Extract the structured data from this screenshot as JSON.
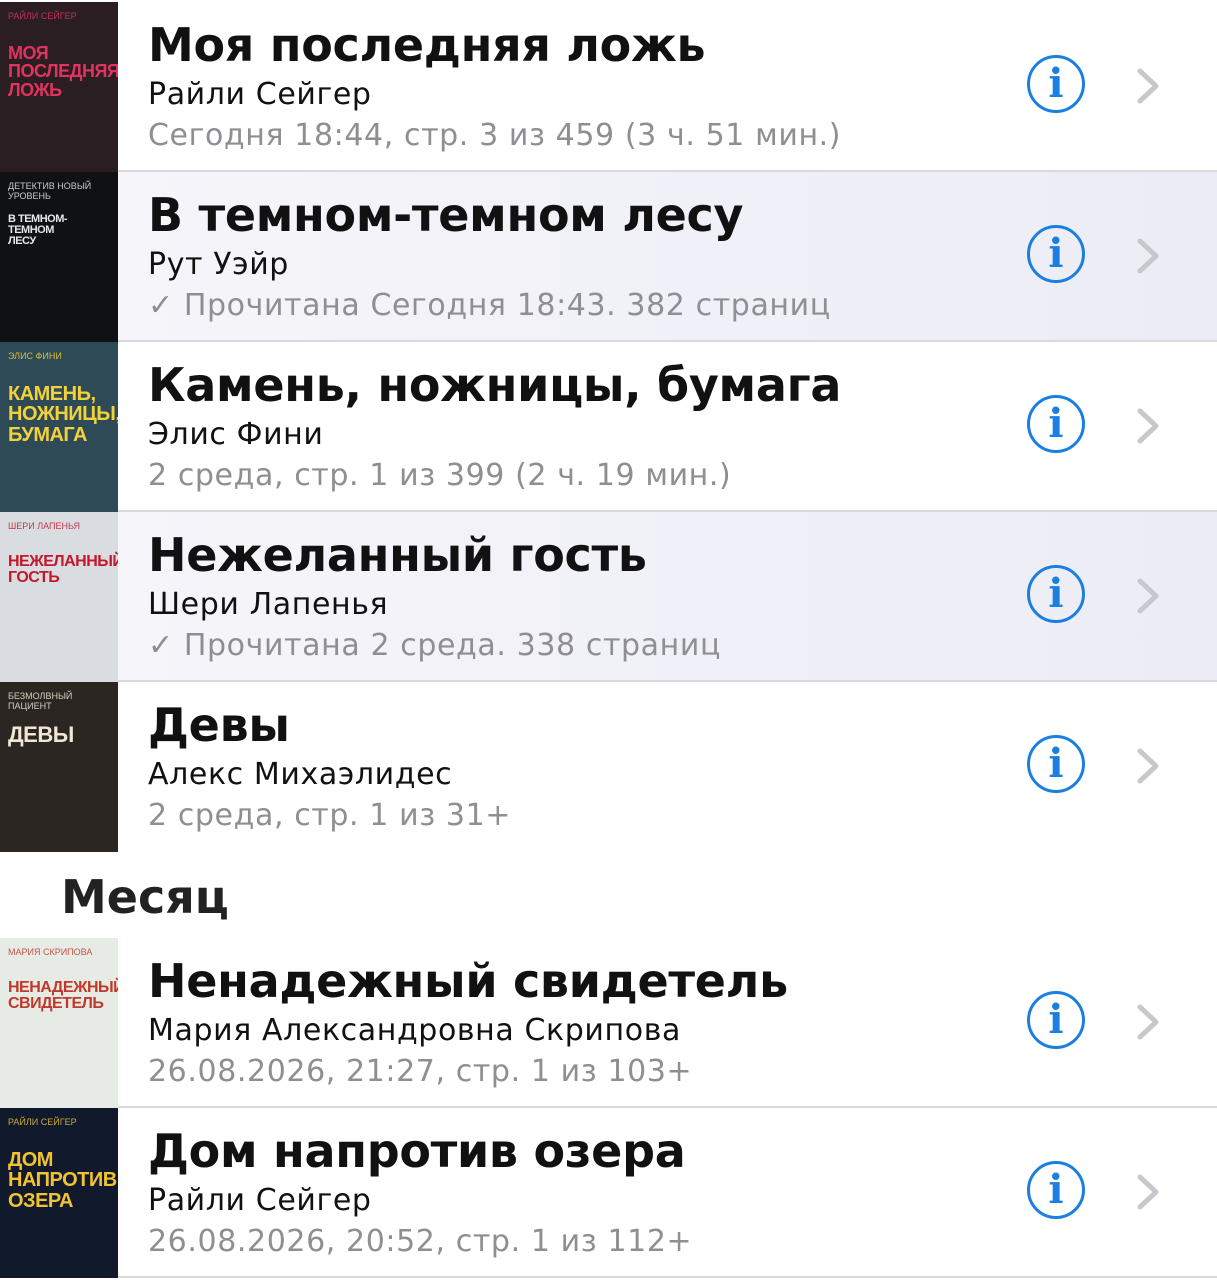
{
  "books_recent": [
    {
      "title": "Моя последняя ложь",
      "author": "Райли Сейгер",
      "status": "Сегодня 18:44, стр. 3 из 459 (3 ч. 51 мин.)",
      "finished": false,
      "cover": {
        "lines": [
          "МОЯ",
          "ПОСЛЕДНЯЯ",
          "ЛОЖЬ"
        ],
        "small": "РАЙЛИ СЕЙГЕР",
        "bg": "#2a1e22",
        "fg": "#e0335f"
      }
    },
    {
      "title": "В темном-темном лесу",
      "author": "Рут Уэйр",
      "status": "✓ Прочитана Сегодня 18:43. 382 страниц",
      "finished": true,
      "cover": {
        "lines": [
          "В ТЕМНОМ-ТЕМНОМ",
          "ЛЕСУ"
        ],
        "small": "ДЕТЕКТИВ НОВЫЙ УРОВЕНЬ",
        "bg": "#0f1114",
        "fg": "#e6e6e6"
      }
    },
    {
      "title": "Камень, ножницы, бумага",
      "author": "Элис Фини",
      "status": "2 среда, стр. 1 из 399 (2 ч. 19 мин.)",
      "finished": false,
      "cover": {
        "lines": [
          "КАМЕНЬ,",
          "НОЖНИЦЫ,",
          "БУМАГА"
        ],
        "small": "ЭЛИС ФИНИ",
        "bg": "#2f4a57",
        "fg": "#f2d23a"
      }
    },
    {
      "title": "Нежеланный гость",
      "author": "Шери Лапенья",
      "status": "✓ Прочитана 2 среда. 338 страниц",
      "finished": true,
      "cover": {
        "lines": [
          "НЕЖЕЛАННЫЙ",
          "ГОСТЬ"
        ],
        "small": "ШЕРИ ЛАПЕНЬЯ",
        "bg": "#d9dde2",
        "fg": "#c4182a"
      }
    },
    {
      "title": "Девы",
      "author": "Алекс Михаэлидес",
      "status": "2 среда, стр. 1 из 31+",
      "finished": false,
      "cover": {
        "lines": [
          "ДЕВЫ"
        ],
        "small": "БЕЗМОЛВНЫЙ ПАЦИЕНТ",
        "bg": "#2b2622",
        "fg": "#f0e6d6"
      }
    }
  ],
  "section_month": "Месяц",
  "books_month": [
    {
      "title": "Ненадежный свидетель",
      "author": "Мария Александровна Скрипова",
      "status": "26.08.2026, 21:27, стр. 1 из 103+",
      "finished": false,
      "cover": {
        "lines": [
          "НЕНАДЕЖНЫЙ",
          "СВИДЕТЕЛЬ"
        ],
        "small": "МАРИЯ СКРИПОВА",
        "bg": "#e7ebe6",
        "fg": "#c0392b"
      }
    },
    {
      "title": "Дом напротив озера",
      "author": "Райли Сейгер",
      "status": "26.08.2026, 20:52, стр. 1 из 112+",
      "finished": false,
      "cover": {
        "lines": [
          "ДОМ",
          "НАПРОТИВ",
          "ОЗЕРА"
        ],
        "small": "Райли Сейгер",
        "bg": "#101a2c",
        "fg": "#f1c232"
      }
    }
  ],
  "info_glyph": "i",
  "colors": {
    "accent": "#1a7fe0",
    "secondary_text": "#8e8e93",
    "chevron": "#c7c7cc"
  }
}
